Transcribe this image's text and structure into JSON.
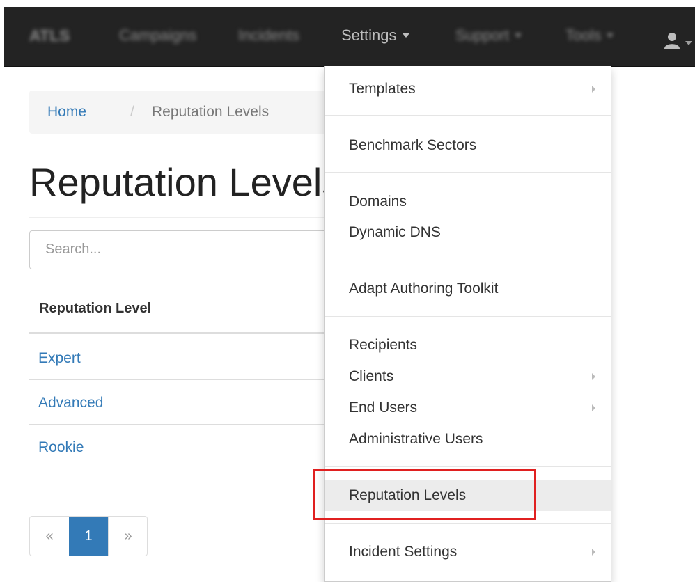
{
  "navbar": {
    "brand": "ATLS",
    "items": [
      "Campaigns",
      "Incidents",
      "Settings",
      "Support",
      "Tools"
    ],
    "user_icon": "user-icon"
  },
  "breadcrumb": {
    "home": "Home",
    "separator": "/",
    "current": "Reputation Levels"
  },
  "page": {
    "title": "Reputation Levels"
  },
  "search": {
    "placeholder": "Search..."
  },
  "table": {
    "header": "Reputation Level",
    "rows": [
      "Expert",
      "Advanced",
      "Rookie"
    ]
  },
  "pagination": {
    "prev": "«",
    "current": "1",
    "next": "»"
  },
  "dropdown": {
    "items": [
      "Templates",
      "Benchmark Sectors",
      "Domains",
      "Dynamic DNS",
      "Adapt Authoring Toolkit",
      "Recipients",
      "Clients",
      "End Users",
      "Administrative Users",
      "Reputation Levels",
      "Incident Settings"
    ],
    "active": "Reputation Levels",
    "highlight_color": "#e02020"
  }
}
